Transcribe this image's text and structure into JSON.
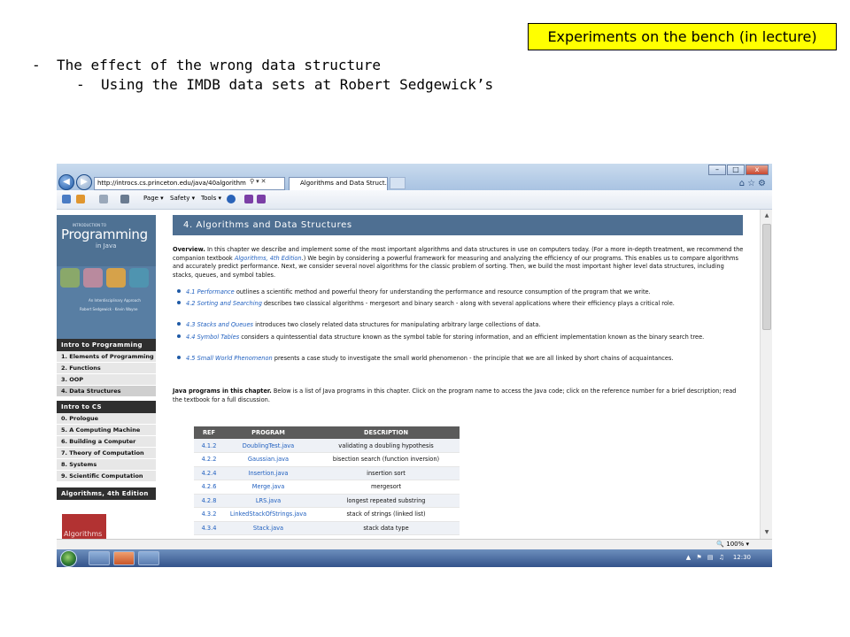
{
  "slide": {
    "tag": "Experiments on the bench (in lecture)",
    "bullet1": "The effect of the wrong data structure",
    "bullet2": "Using the IMDB data sets at Robert Sedgewick’s",
    "dash": "-"
  },
  "browser": {
    "address": "http://introcs.cs.princeton.edu/java/40algorithm",
    "tab_title": "Algorithms and Data Struct...",
    "window_buttons": [
      "–",
      "□",
      "x"
    ],
    "commands": [
      "Page ▾",
      "Safety ▾",
      "Tools ▾"
    ],
    "zoom": "🔍 100%  ▾",
    "clock": "12:30"
  },
  "sidebar": {
    "cover_intro": "INTRODUCTION TO",
    "cover_title": "Programming",
    "cover_sub": "in Java",
    "cover_interdisc": "An Interdisciplinary Approach",
    "cover_authors": "Robert Sedgewick · Kevin Wayne",
    "section1": "Intro to Programming",
    "section1_items": [
      "1.  Elements of Programming",
      "2.  Functions",
      "3.  OOP",
      "4.  Data Structures"
    ],
    "section2": "Intro to CS",
    "section2_items": [
      "0.  Prologue",
      "5.  A Computing Machine",
      "6.  Building a Computer",
      "7.  Theory of Computation",
      "8.  Systems",
      "9.  Scientific Computation"
    ],
    "section3": "Algorithms, 4th Edition",
    "redbook_title": "Algorithms"
  },
  "content": {
    "chapter_title": "4.   Algorithms and Data Structures",
    "overview_label": "Overview.",
    "overview_text": " In this chapter we describe and implement some of the most important algorithms and data structures in use on computers today. (For a more in-depth treatment, we recommend the companion textbook ",
    "overview_link": "Algorithms, 4th Edition",
    "overview_text2": ".) We begin by considering a powerful framework for measuring and analyzing the efficiency of our programs. This enables us to compare algorithms and accurately predict performance. Next, we consider several novel algorithms for the classic problem of sorting. Then, we build the most important higher level data structures, including stacks, queues, and symbol tables.",
    "bullets": [
      {
        "link": "4.1 Performance",
        "text": " outlines a scientific method and powerful theory for understanding the performance and resource consumption of the program that we write."
      },
      {
        "link": "4.2 Sorting and Searching",
        "text": " describes two classical algorithms - mergesort and binary search - along with several applications where their efficiency plays a critical role."
      },
      {
        "link": "4.3 Stacks and Queues",
        "text": " introduces two closely related data structures for manipulating arbitrary large collections of data."
      },
      {
        "link": "4.4 Symbol Tables",
        "text": " considers a quintessential data structure known as the symbol table for storing information, and an efficient implementation known as the binary search tree."
      },
      {
        "link": "4.5 Small World Phenomenon",
        "text": " presents a case study to investigate the small world phenomenon - the principle that we are all linked by short chains of acquaintances."
      }
    ],
    "programs_label": "Java programs in this chapter.",
    "programs_text": " Below is a list of Java programs in this chapter. Click on the program name to access the Java code; click on the reference number for a brief description; read the textbook for a full discussion.",
    "table_headers": [
      "REF",
      "PROGRAM",
      "DESCRIPTION"
    ],
    "table_rows": [
      [
        "4.1.2",
        "DoublingTest.java",
        "validating a doubling hypothesis"
      ],
      [
        "4.2.2",
        "Gaussian.java",
        "bisection search (function inversion)"
      ],
      [
        "4.2.4",
        "Insertion.java",
        "insertion sort"
      ],
      [
        "4.2.6",
        "Merge.java",
        "mergesort"
      ],
      [
        "4.2.8",
        "LRS.java",
        "longest repeated substring"
      ],
      [
        "4.3.2",
        "LinkedStackOfStrings.java",
        "stack of strings (linked list)"
      ],
      [
        "4.3.4",
        "Stack.java",
        "stack data type"
      ]
    ]
  }
}
